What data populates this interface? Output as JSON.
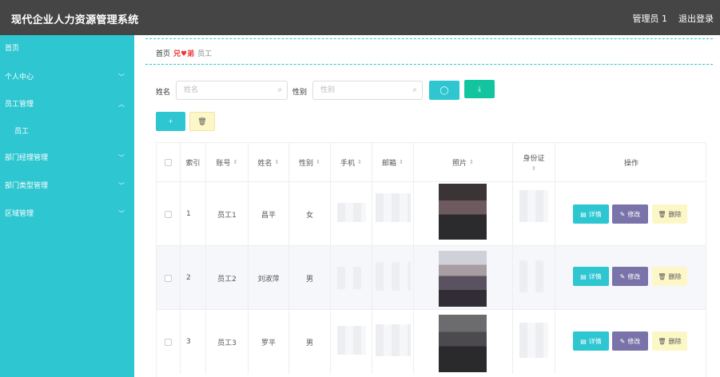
{
  "app": {
    "title": "现代企业人力资源管理系统",
    "user": "管理员 1",
    "logout": "退出登录"
  },
  "sidebar": {
    "home": "首页",
    "personal": "个人中心",
    "employee_mgmt": "员工管理",
    "employee": "员工",
    "dept_manager": "部门经理管理",
    "dept_type": "部门类型管理",
    "region": "区域管理"
  },
  "breadcrumb": {
    "home": "首页",
    "sep": "兄♥弟",
    "current": "员工"
  },
  "search": {
    "name_label": "姓名",
    "name_placeholder": "姓名",
    "gender_label": "性别",
    "gender_placeholder": "性别"
  },
  "buttons": {
    "add": "+",
    "delete": "🗑"
  },
  "table": {
    "headers": {
      "index": "索引",
      "account": "账号",
      "name": "姓名",
      "gender": "性别",
      "phone": "手机",
      "email": "邮箱",
      "photo": "照片",
      "idcard": "身份证",
      "ops": "操作"
    },
    "actions": {
      "detail": "详情",
      "edit": "修改",
      "delete": "删除"
    },
    "rows": [
      {
        "index": "1",
        "account": "员工1",
        "name": "昌平",
        "gender": "女"
      },
      {
        "index": "2",
        "account": "员工2",
        "name": "刘淑萍",
        "gender": "男"
      },
      {
        "index": "3",
        "account": "员工3",
        "name": "罗平",
        "gender": "男"
      }
    ]
  },
  "colors": {
    "accent": "#2dc6d1",
    "topbar": "#454545",
    "download": "#12c4a0",
    "edit": "#7a73a9",
    "delete": "#fdf7c8"
  }
}
